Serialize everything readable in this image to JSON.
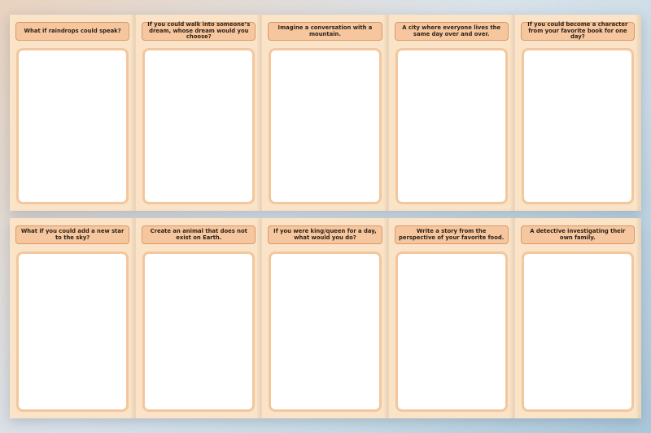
{
  "cards_top": [
    {
      "prompt": "What if raindrops could speak?"
    },
    {
      "prompt": "If you could walk into someone’s dream, whose dream would you choose?"
    },
    {
      "prompt": "Imagine a conversation with a mountain."
    },
    {
      "prompt": "A city where everyone lives the same day over and over."
    },
    {
      "prompt": "If you could become a character from your favorite book for one day?"
    }
  ],
  "cards_bottom": [
    {
      "prompt": "What if you could add a new star to the sky?"
    },
    {
      "prompt": "Create an animal that does not exist on Earth."
    },
    {
      "prompt": "If you were king/queen for a day, what would you do?"
    },
    {
      "prompt": "Write a story from the perspective of your favorite food."
    },
    {
      "prompt": "A detective investigating their own family."
    }
  ],
  "colors": {
    "card_bg": "#fbe3c7",
    "title_bg": "#f6c79e",
    "title_border": "#d89a6c",
    "box_border": "#f3c79d"
  }
}
